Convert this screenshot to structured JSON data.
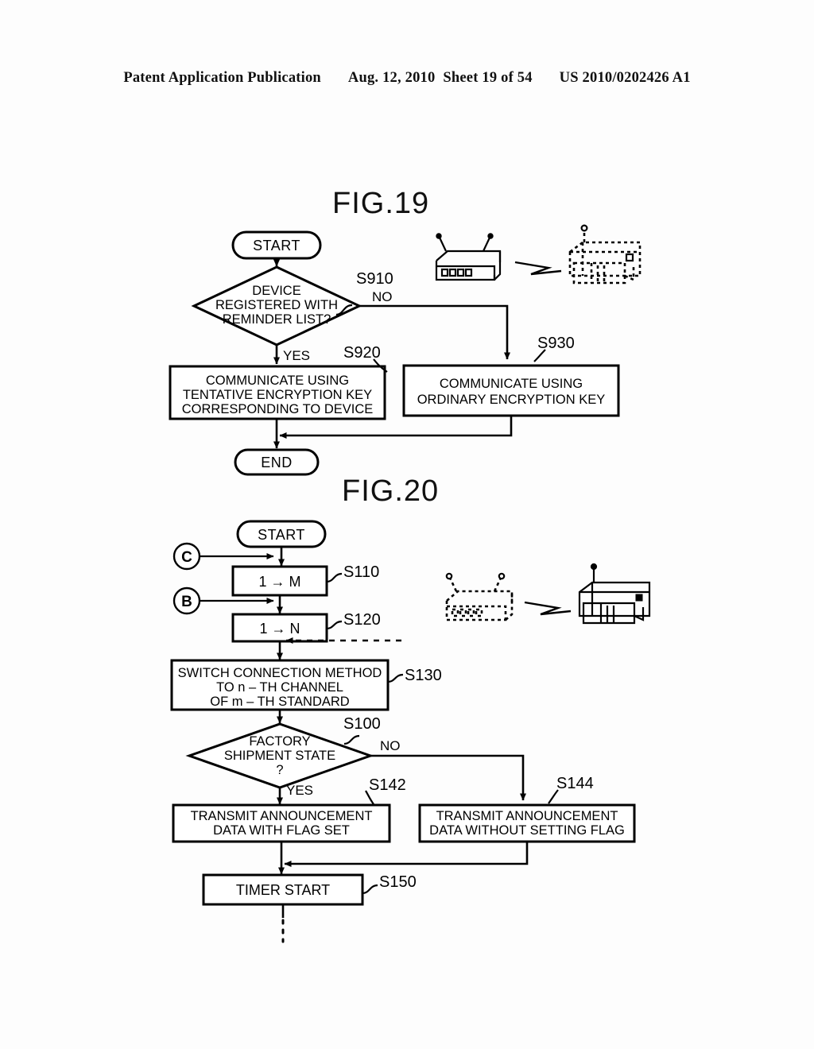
{
  "page": {
    "header": {
      "publication": "Patent Application Publication",
      "date": "Aug. 12, 2010",
      "sheet": "Sheet 19 of 54",
      "number": "US 2010/0202426 A1"
    },
    "background_color": "#ffffff",
    "ink_color": "#000000"
  },
  "figures": [
    {
      "id": "fig19",
      "title": "FIG.19",
      "nodes": {
        "start": "START",
        "decision": [
          "DEVICE",
          "REGISTERED WITH",
          "REMINDER LIST?"
        ],
        "decision_ref": "S910",
        "yes_label": "YES",
        "no_label": "NO",
        "yes_box": [
          "COMMUNICATE USING",
          "TENTATIVE ENCRYPTION KEY",
          "CORRESPONDING TO DEVICE"
        ],
        "yes_box_ref": "S920",
        "no_box": [
          "COMMUNICATE USING",
          "ORDINARY ENCRYPTION KEY"
        ],
        "no_box_ref": "S930",
        "end": "END"
      },
      "illustration": {
        "left_device": "access-point-solid",
        "link": "wireless-bolt",
        "right_device": "printer-dashed"
      }
    },
    {
      "id": "fig20",
      "title": "FIG.20",
      "nodes": {
        "start": "START",
        "connector_c": "C",
        "connector_b": "B",
        "box_s110": "1 → M",
        "ref_s110": "S110",
        "box_s120": "1 → N",
        "ref_s120": "S120",
        "box_s130": [
          "SWITCH CONNECTION METHOD",
          "TO n – TH CHANNEL",
          "OF m – TH STANDARD"
        ],
        "ref_s130": "S130",
        "decision": [
          "FACTORY",
          "SHIPMENT STATE",
          "?"
        ],
        "ref_s100": "S100",
        "yes_label": "YES",
        "no_label": "NO",
        "box_s142": [
          "TRANSMIT ANNOUNCEMENT",
          "DATA WITH FLAG SET"
        ],
        "ref_s142": "S142",
        "box_s144": [
          "TRANSMIT ANNOUNCEMENT",
          "DATA WITHOUT SETTING FLAG"
        ],
        "ref_s144": "S144",
        "box_s150": "TIMER START",
        "ref_s150": "S150"
      },
      "illustration": {
        "left_device": "access-point-dashed",
        "link": "wireless-bolt",
        "right_device": "printer-solid"
      }
    }
  ]
}
